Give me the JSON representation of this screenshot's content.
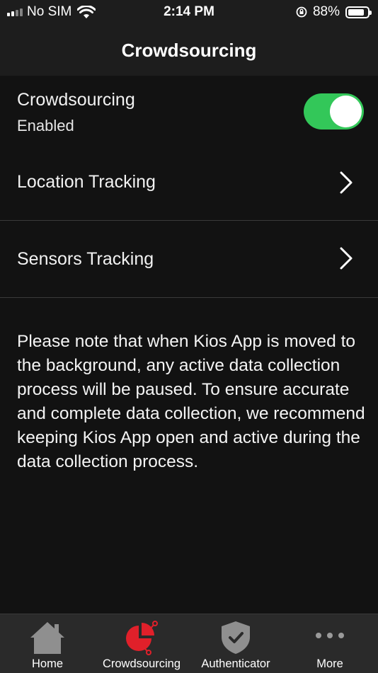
{
  "status_bar": {
    "carrier": "No SIM",
    "time": "2:14 PM",
    "battery_percent": "88%",
    "battery_level": 0.88,
    "icons": [
      "signal-icon",
      "wifi-icon",
      "orientation-lock-icon",
      "battery-icon"
    ]
  },
  "nav": {
    "title": "Crowdsourcing"
  },
  "settings": {
    "crowdsourcing_label": "Crowdsourcing",
    "crowdsourcing_status": "Enabled",
    "crowdsourcing_enabled": true,
    "location_label": "Location Tracking",
    "sensors_label": "Sensors Tracking"
  },
  "note": "Please note that when Kios App is moved to the background, any active data collection process will be paused. To ensure accurate and complete data collection, we recommend keeping Kios App open and active during the data collection process.",
  "tabs": [
    {
      "label": "Home",
      "icon": "home-icon"
    },
    {
      "label": "Crowdsourcing",
      "icon": "crowdsourcing-icon",
      "selected": true
    },
    {
      "label": "Authenticator",
      "icon": "shield-check-icon"
    },
    {
      "label": "More",
      "icon": "more-dots-icon"
    }
  ],
  "colors": {
    "background": "#121212",
    "bar": "#1d1d1d",
    "toggle_on": "#33c759",
    "tab_active": "#e0202a",
    "tab_inactive": "#9a9a9a"
  }
}
